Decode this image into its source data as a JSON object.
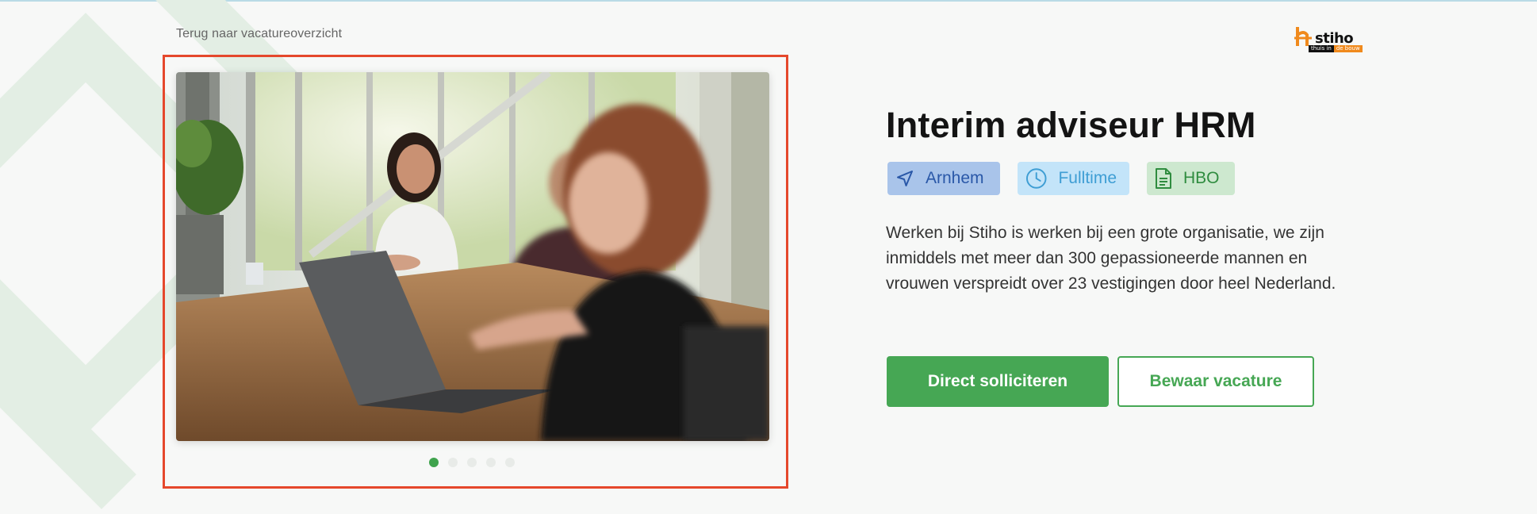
{
  "nav": {
    "back_label": "Terug naar vacatureoverzicht"
  },
  "logo": {
    "word": "stiho",
    "tag_part1": "thuis in",
    "tag_part2": "de bouw"
  },
  "gallery": {
    "slide_count": 5,
    "active_slide": 1
  },
  "job": {
    "title": "Interim adviseur HRM",
    "tags": {
      "location": "Arnhem",
      "hours": "Fulltime",
      "education": "HBO"
    },
    "intro": "Werken bij Stiho is werken bij een grote organisatie, we zijn inmiddels met meer dan 300 gepassioneerde mannen en vrouwen verspreidt over 23 vestigingen door heel Nederland."
  },
  "actions": {
    "apply_label": "Direct solliciteren",
    "save_label": "Bewaar vacature"
  },
  "colors": {
    "brand_green": "#46a754",
    "highlight_border": "#e5482c",
    "logo_orange": "#f08a1d"
  }
}
